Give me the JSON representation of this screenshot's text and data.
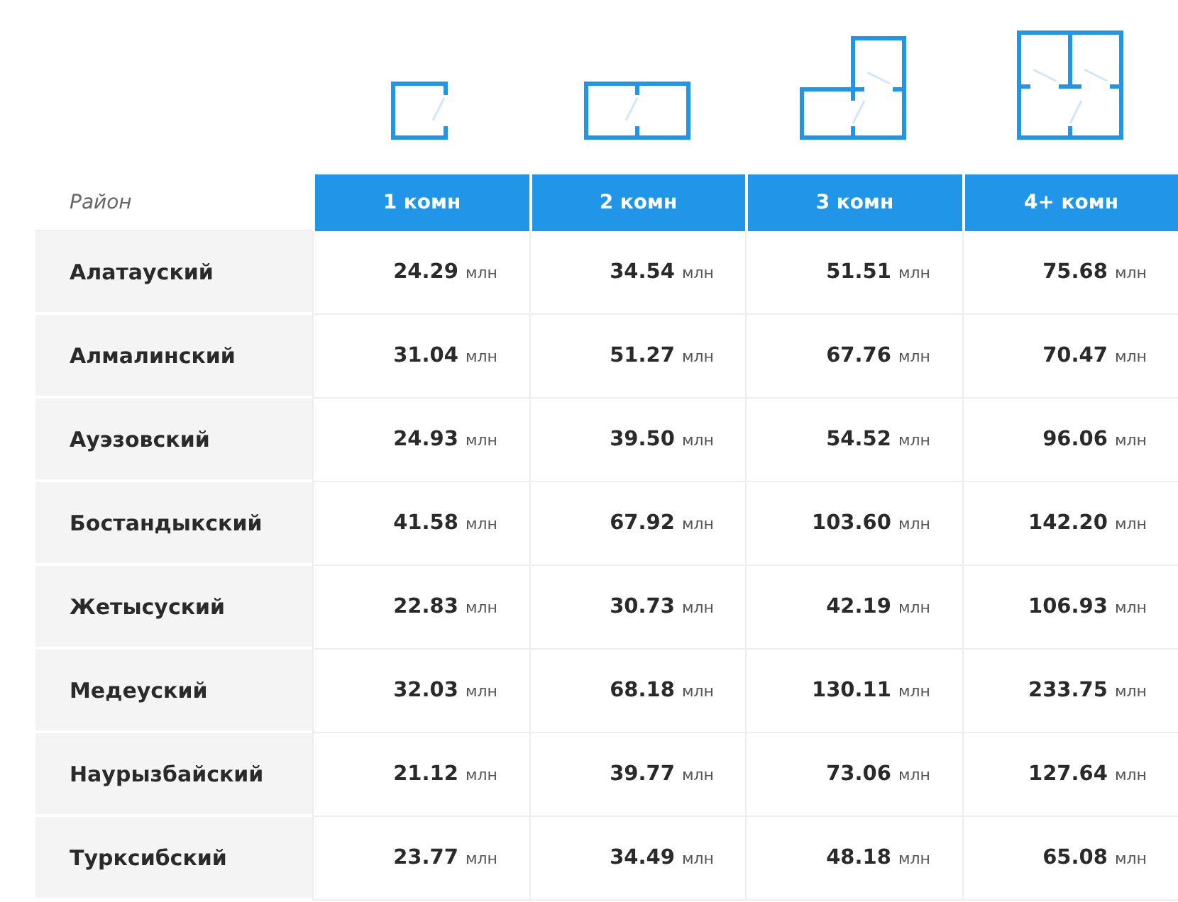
{
  "table": {
    "corner_label": "Район",
    "columns": [
      "1 комн",
      "2 комн",
      "3 комн",
      "4+ комн"
    ],
    "rows": [
      {
        "district": "Алатауский",
        "cells": [
          {
            "value": "24.29",
            "unit": "млн"
          },
          {
            "value": "34.54",
            "unit": "млн"
          },
          {
            "value": "51.51",
            "unit": "млн"
          },
          {
            "value": "75.68",
            "unit": "млн"
          }
        ]
      },
      {
        "district": "Алмалинский",
        "cells": [
          {
            "value": "31.04",
            "unit": "млн"
          },
          {
            "value": "51.27",
            "unit": "млн"
          },
          {
            "value": "67.76",
            "unit": "млн"
          },
          {
            "value": "70.47",
            "unit": "млн"
          }
        ]
      },
      {
        "district": "Ауэзовский",
        "cells": [
          {
            "value": "24.93",
            "unit": "млн"
          },
          {
            "value": "39.50",
            "unit": "млн"
          },
          {
            "value": "54.52",
            "unit": "млн"
          },
          {
            "value": "96.06",
            "unit": "млн"
          }
        ]
      },
      {
        "district": "Бостандыкский",
        "cells": [
          {
            "value": "41.58",
            "unit": "млн"
          },
          {
            "value": "67.92",
            "unit": "млн"
          },
          {
            "value": "103.60",
            "unit": "млн"
          },
          {
            "value": "142.20",
            "unit": "млн"
          }
        ]
      },
      {
        "district": "Жетысуский",
        "cells": [
          {
            "value": "22.83",
            "unit": "млн"
          },
          {
            "value": "30.73",
            "unit": "млн"
          },
          {
            "value": "42.19",
            "unit": "млн"
          },
          {
            "value": "106.93",
            "unit": "млн"
          }
        ]
      },
      {
        "district": "Медеуский",
        "cells": [
          {
            "value": "32.03",
            "unit": "млн"
          },
          {
            "value": "68.18",
            "unit": "млн"
          },
          {
            "value": "130.11",
            "unit": "млн"
          },
          {
            "value": "233.75",
            "unit": "млн"
          }
        ]
      },
      {
        "district": "Наурызбайский",
        "cells": [
          {
            "value": "21.12",
            "unit": "млн"
          },
          {
            "value": "39.77",
            "unit": "млн"
          },
          {
            "value": "73.06",
            "unit": "млн"
          },
          {
            "value": "127.64",
            "unit": "млн"
          }
        ]
      },
      {
        "district": "Турксибский",
        "cells": [
          {
            "value": "23.77",
            "unit": "млн"
          },
          {
            "value": "34.49",
            "unit": "млн"
          },
          {
            "value": "48.18",
            "unit": "млн"
          },
          {
            "value": "65.08",
            "unit": "млн"
          }
        ]
      }
    ]
  }
}
